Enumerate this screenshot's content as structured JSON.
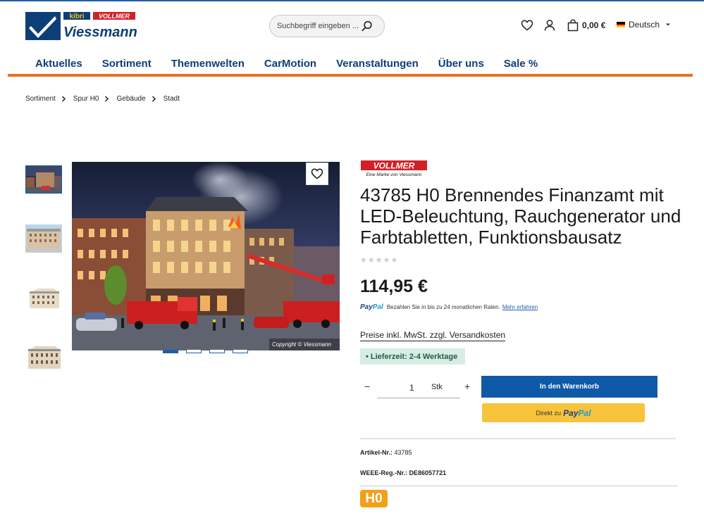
{
  "colors": {
    "brand_blue": "#0d3e78",
    "accent_orange": "#e8701e",
    "button_blue": "#0f5aa8",
    "paypal_yellow": "#f7c33b",
    "delivery_bg": "#d6ece4"
  },
  "header": {
    "logo": {
      "kibri": "kibri",
      "vollmer": "VOLLMER",
      "viessmann": "Viessmann"
    },
    "search": {
      "placeholder": "Suchbegriff eingeben ...",
      "icon": "search-icon"
    },
    "wishlist_icon": "heart-icon",
    "account_icon": "user-icon",
    "cart_icon": "shopping-bag-icon",
    "cart_total": "0,00 €",
    "language": "Deutsch"
  },
  "nav": {
    "items": [
      "Aktuelles",
      "Sortiment",
      "Themenwelten",
      "CarMotion",
      "Veranstaltungen",
      "Über uns",
      "Sale %"
    ]
  },
  "breadcrumb": [
    "Sortiment",
    "Spur H0",
    "Gebäude",
    "Stadt"
  ],
  "gallery": {
    "thumbnail_count": 4,
    "active_slide": 1,
    "slide_count": 4,
    "watermark": "Copyright © Viessmann"
  },
  "product": {
    "brand_logo": {
      "name": "VOLLMER",
      "tagline": "Eine Marke von Viessmann"
    },
    "title": "43785 H0 Brennendes Finanzamt mit LED-Beleuchtung, Rauchgenerator und Farbtabletten, Funktionsbausatz",
    "rating": "★★★★★",
    "price": "114,95 €",
    "paypal": {
      "logo_part1": "Pay",
      "logo_part2": "Pal",
      "text": "Bezahlen Sie in bis zu 24 monatlichen Raten.",
      "link": "Mehr erfahren"
    },
    "tax_note": "Preise inkl. MwSt. zzgl. Versandkosten",
    "delivery": "• Lieferzeit: 2-4 Werktage",
    "quantity": {
      "minus": "−",
      "value": "1",
      "unit": "Stk",
      "plus": "+"
    },
    "add_to_cart": "In den Warenkorb",
    "paypal_button": {
      "prefix": "Direkt zu",
      "word1": "Pay",
      "word2": "Pal"
    },
    "specs": [
      {
        "label": "Artikel-Nr.:",
        "value": "43785"
      },
      {
        "label": "WEEE-Reg.-Nr.:",
        "value": "DE86057721"
      }
    ],
    "scale_badge": "H0"
  }
}
